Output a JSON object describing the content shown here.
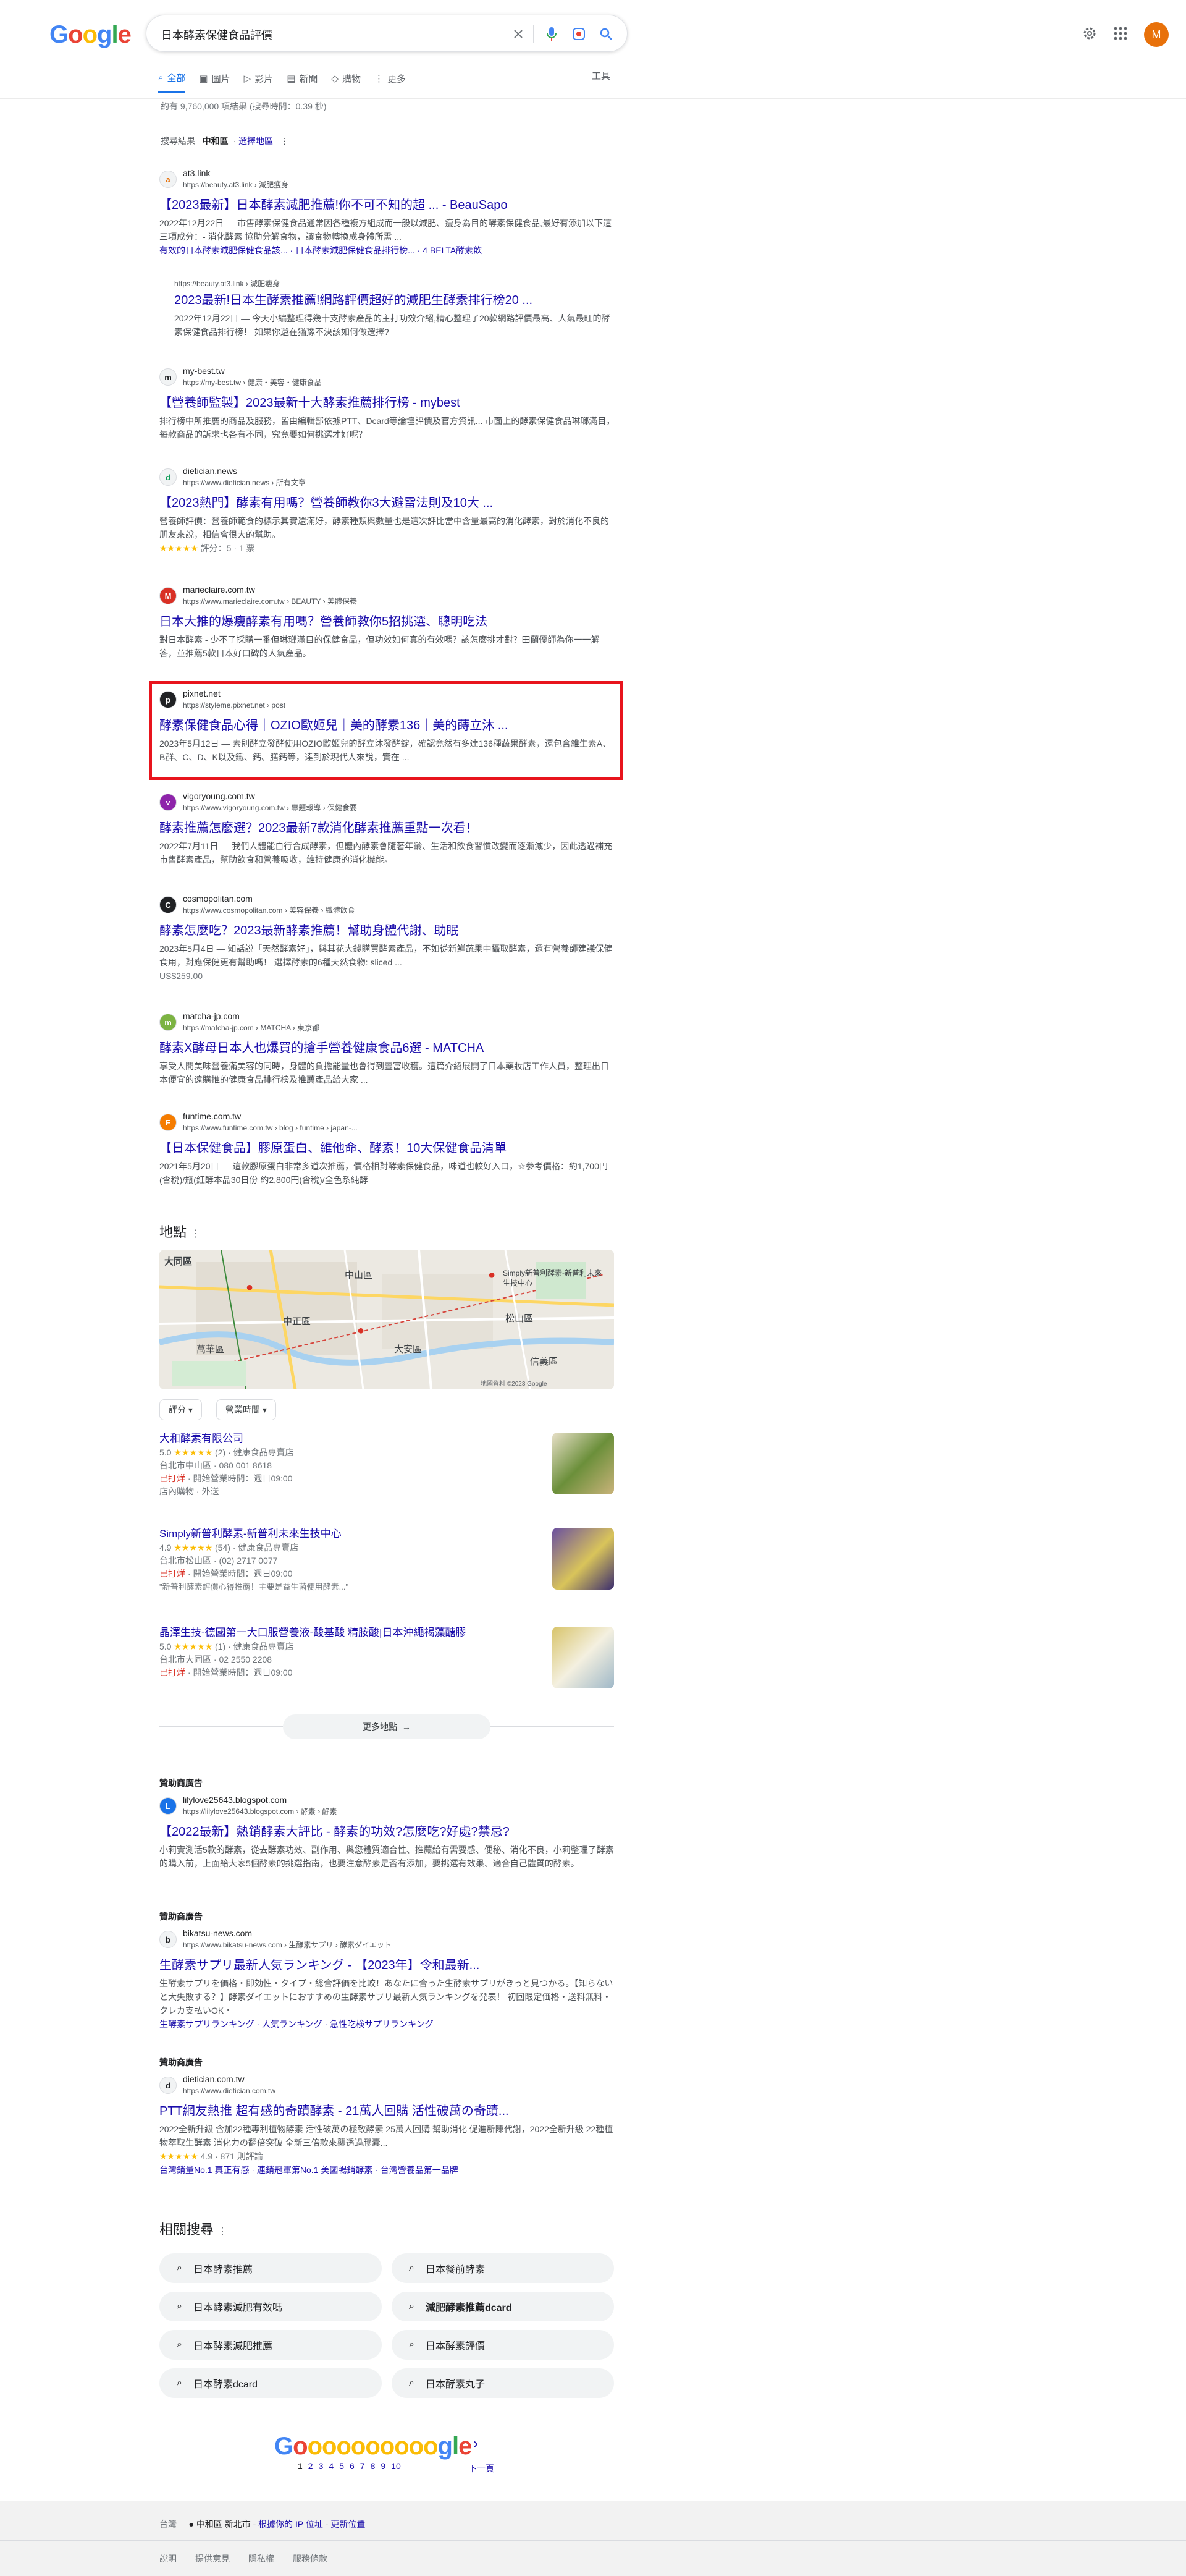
{
  "header": {
    "logo_letters": [
      "G",
      "o",
      "o",
      "g",
      "l",
      "e"
    ],
    "search_query": "日本酵素保健食品評價",
    "avatar_letter": "M",
    "tabs": [
      {
        "label": "全部",
        "icon": "search-icon",
        "active": true
      },
      {
        "label": "圖片",
        "icon": "image-icon"
      },
      {
        "label": "影片",
        "icon": "video-icon"
      },
      {
        "label": "新聞",
        "icon": "news-icon"
      },
      {
        "label": "購物",
        "icon": "tag-icon"
      },
      {
        "label": "更多",
        "icon": "more-vert-icon"
      }
    ],
    "tools_label": "工具"
  },
  "stats": "約有 9,760,000 項結果 (搜尋時間：0.39 秒)",
  "location_line": {
    "prefix": "搜尋結果",
    "place": "中和區",
    "link": "選擇地區"
  },
  "results": [
    {
      "site": "at3.link",
      "url": "https://beauty.at3.link › 減肥瘦身",
      "favicon": "a",
      "title": "【2023最新】日本酵素減肥推薦!你不可不知的超 ... - BeauSapo",
      "snippet": "2022年12月22日 — 市售酵素保健食品通常因各種複方組成而一般以減肥、瘦身為目的酵素保健食品,最好有添加以下這三項成分：- 消化酵素 協助分解食物，讓食物轉換成身體所需 ...",
      "sitelinks": "有效的日本酵素減肥保健食品該... · 日本酵素減肥保健食品排行榜... · 4 BELTA酵素飲"
    },
    {
      "url": "https://beauty.at3.link › 減肥瘦身",
      "title": "2023最新!日本生酵素推薦!網路評價超好的減肥生酵素排行榜20 ...",
      "snippet": "2022年12月22日 — 今天小編整理得幾十支酵素產品的主打功效介紹,精心整理了20款網路評價最高、人氣最旺的酵素保健食品排行榜！ 如果你還在猶豫不決該如何做選擇?"
    },
    {
      "site": "my-best.tw",
      "url": "https://my-best.tw › 健康・美容・健康食品",
      "favicon": "m",
      "title": "【營養師監製】2023最新十大酵素推薦排行榜 - mybest",
      "snippet": "排行榜中所推薦的商品及服務，皆由編輯部依據PTT、Dcard等論壇評價及官方資訊... 市面上的酵素保健食品琳瑯滿目，每款商品的訴求也各有不同，究竟要如何挑選才好呢？"
    },
    {
      "site": "dietician.news",
      "url": "https://www.dietician.news › 所有文章",
      "favicon": "d",
      "title": "【2023熱門】酵素有用嗎？營養師教你3大避雷法則及10大 ...",
      "snippet": "營養師評價：營養師範食的標示其實還滿好，酵素種類與數量也是這次評比當中含量最高的消化酵素，對於消化不良的朋友來說，相信會很大的幫助。",
      "rating": "評分：5 · 1 票"
    },
    {
      "site": "marieclaire.com.tw",
      "url": "https://www.marieclaire.com.tw › BEAUTY › 美體保養",
      "favicon": "M",
      "title": "日本大推的爆瘦酵素有用嗎？營養師教你5招挑選、聰明吃法",
      "snippet": "對日本酵素 - 少不了採購一番但琳瑯滿目的保健食品，但功效如何真的有效嗎？該怎麼挑才對？田蘭優師為你一一解答，並推薦5款日本好口碑的人氣產品。"
    },
    {
      "site": "pixnet.net",
      "url": "https://styleme.pixnet.net › post",
      "favicon": "p",
      "title": "酵素保健食品心得｜OZIO歐姬兒｜美的酵素136｜美的蒔立沐 ...",
      "snippet": "2023年5月12日 — 素則酵立發酵使用OZIO歐姬兒的酵立沐發酵錠，確認竟然有多達136種蔬果酵素，還包含維生素A、B群、C、D、K以及鐵、鈣、膳鈣等，達到於現代人來說，實在 ..."
    },
    {
      "site": "vigoryoung.com.tw",
      "url": "https://www.vigoryoung.com.tw › 專題報導 › 保健食要",
      "favicon": "v",
      "title": "酵素推薦怎麼選？2023最新7款消化酵素推薦重點一次看！",
      "snippet": "2022年7月11日 — 我們人體能自行合成酵素，但體內酵素會隨著年齡、生活和飲食習慣改變而逐漸減少，因此透過補充市售酵素產品，幫助飲食和營養吸收，維持健康的消化機能。"
    },
    {
      "site": "cosmopolitan.com",
      "url": "https://www.cosmopolitan.com › 美容保養 › 纖體飲食",
      "favicon": "C",
      "title": "酵素怎麼吃？2023最新酵素推薦！幫助身體代謝、助眠",
      "snippet": "2023年5月4日 — 知話說「天然酵素好」，與其花大錢購買酵素產品，不如從新鮮蔬果中攝取酵素，還有營養師建議保健食用，對應保健更有幫助嗎！ 選擇酵素的6種天然食物: sliced ...",
      "price": "US$259.00"
    },
    {
      "site": "matcha-jp.com",
      "url": "https://matcha-jp.com › MATCHA › 東京都",
      "favicon": "m",
      "title": "酵素X酵母日本人也爆買的搶手營養健康食品6選 - MATCHA",
      "snippet": "享受人間美味營養滿美容的同時，身體的負擔能量也會得到豐富收穫。這篇介紹展開了日本藥妝店工作人員，整理出日本便宜的遠購推的健康食品排行榜及推薦產品給大家 ..."
    },
    {
      "site": "funtime.com.tw",
      "url": "https://www.funtime.com.tw › blog › funtime › japan-...",
      "favicon": "F",
      "title": "【日本保健食品】膠原蛋白、維他命、酵素！10大保健食品清單",
      "snippet": "2021年5月20日 — 這款膠原蛋白非常多道次推薦，價格相對酵素保健食品，味道也較好入口，☆參考價格：約1,700円(含稅)/瓶(紅酵本品30日份 約2,800円(含稅)/全色系純酵"
    }
  ],
  "places": {
    "heading": "地點",
    "map_labels": [
      "大同區",
      "中山區",
      "松山區",
      "萬華區",
      "中正區",
      "大安區",
      "信義區"
    ],
    "map_callout": "Simply新普利酵素-新普利未來生技中心",
    "map_credit": "地圖資料 ©2023 Google",
    "filters": [
      "評分",
      "營業時間"
    ],
    "items": [
      {
        "name": "大和酵素有限公司",
        "rating": "5.0",
        "stars": "★★★★★",
        "reviews": "(2)",
        "category": "健康食品專賣店",
        "address": "台北市中山區 · 080 001 8618",
        "open": "已打烊",
        "hours": " · 開始營業時間：週日09:00",
        "extra": "店內購物 · 外送"
      },
      {
        "name": "Simply新普利酵素-新普利未來生技中心",
        "rating": "4.9",
        "stars": "★★★★★",
        "reviews": "(54)",
        "category": "健康食品專賣店",
        "address": "台北市松山區 · (02) 2717 0077",
        "open": "已打烊",
        "hours": " · 開始營業時間：週日09:00",
        "extra": "\"新普利酵素評價心得推薦！主要是益生菌使用酵素...\""
      },
      {
        "name": "晶澤生技-德國第一大口服營養液-酸基酸 精胺酸|日本沖繩褐藻醣膠",
        "rating": "5.0",
        "stars": "★★★★★",
        "reviews": "(1)",
        "category": "健康食品專賣店",
        "address": "台北市大同區 · 02 2550 2208",
        "open": "已打烊",
        "hours": " · 開始營業時間：週日09:00"
      }
    ],
    "more_label": "更多地點"
  },
  "ads": [
    {
      "label": "贊助商廣告",
      "site": "lilylove25643.blogspot.com",
      "url": "https://lilylove25643.blogspot.com › 酵素 › 酵素",
      "favicon": "L",
      "title": "【2022最新】熱銷酵素大評比 - 酵素的功效?怎麼吃?好處?禁忌?",
      "snippet": "小莉實測活5款的酵素，從去酵素功效、副作用、與您體質適合性、推薦給有需要感、便秘、消化不良，小莉整理了酵素的購入前，上面給大家5個酵素的挑選指南，也要注意酵素是否有添加，要挑選有效果、適合自己體質的酵素。"
    },
    {
      "label": "贊助商廣告",
      "site": "bikatsu-news.com",
      "url": "https://www.bikatsu-news.com › 生酵素サプリ › 酵素ダイエット",
      "favicon": "b",
      "title": "生酵素サプリ最新人気ランキング - 【2023年】令和最新...",
      "snippet": "生酵素サプリを価格・即効性・タイプ・総合評価を比較！あなたに合った生酵素サプリがきっと見つかる。【知らないと大失敗する？】酵素ダイエットにおすすめの生酵素サプリ最新人気ランキングを発表！ 初回限定価格・送料無料・クレカ支払いOK・",
      "sitelinks": "生酵素サプリランキング · 人気ランキング · 急性吃検サプリランキング"
    },
    {
      "label": "贊助商廣告",
      "site": "dietician.com.tw",
      "url": "https://www.dietician.com.tw",
      "favicon": "d",
      "title": "PTT網友熱推 超有感的奇蹟酵素 - 21萬人回購 活性破萬の奇蹟...",
      "snippet": "2022全新升級 含加22種專利植物酵素 活性破萬の極致酵素 25萬人回購 幫助消化 促進新陳代謝，2022全新升級 22種植物萃取生酵素 消化力の翻倍突破 全新三倍款來襲透過膠囊...",
      "rating": "4.9 · 871 則評論",
      "sitelinks": "台灣銷量No.1 真正有感 · 連銷冠軍第No.1 美國暢銷酵素 · 台灣營養品第一品牌"
    }
  ],
  "related": {
    "heading": "相關搜尋",
    "items": [
      "日本酵素推薦",
      "日本餐前酵素",
      "日本酵素減肥有效嗎",
      "減肥酵素推薦dcard",
      "日本酵素減肥推薦",
      "日本酵素評價",
      "日本酵素dcard",
      "日本酵素丸子"
    ]
  },
  "pagination": {
    "logo_letters": [
      "G",
      "o",
      "o",
      "o",
      "o",
      "o",
      "o",
      "o",
      "o",
      "o",
      "o",
      "g",
      "l",
      "e"
    ],
    "pages": [
      "1",
      "2",
      "3",
      "4",
      "5",
      "6",
      "7",
      "8",
      "9",
      "10"
    ],
    "current": "1",
    "next": "下一頁"
  },
  "footer": {
    "country": "台灣",
    "location": "中和區 新北市",
    "location_link": "根據你的 IP 位址",
    "update_link": "更新位置",
    "links": [
      "說明",
      "提供意見",
      "隱私權",
      "服務條款"
    ]
  },
  "colors": {
    "link": "#1a0dab",
    "highlight_box": "#e8141d",
    "avatar": "#e8710a",
    "accent": "#1a73e8"
  }
}
